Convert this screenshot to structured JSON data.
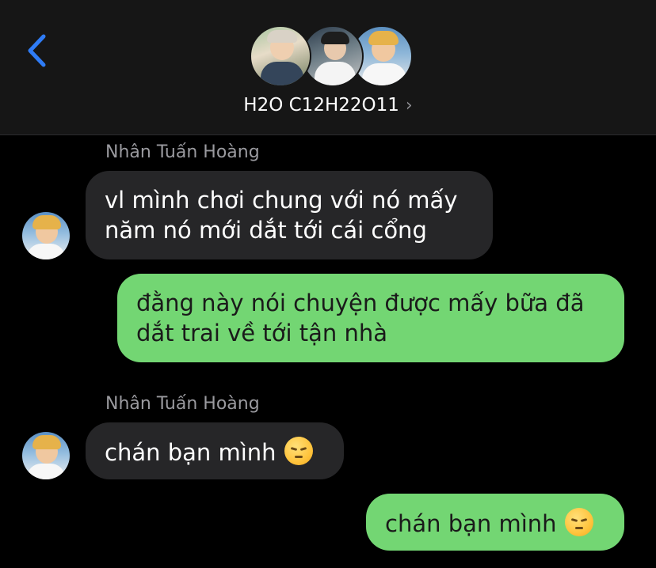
{
  "header": {
    "back_label": "",
    "group_name": "H2O C12H22O11",
    "chevron": "›"
  },
  "messages": [
    {
      "direction": "incoming",
      "sender": "Nhân Tuấn Hoàng",
      "lines": [
        "vl mình chơi chung với nó mấy",
        "năm nó mới dắt tới cái cổng"
      ]
    },
    {
      "direction": "outgoing",
      "lines": [
        "đằng này nói chuyện được mấy bữa đã",
        "dắt trai về tới tận nhà"
      ]
    },
    {
      "direction": "incoming",
      "sender": "Nhân Tuấn Hoàng",
      "text": "chán bạn mình",
      "emoji": "pensive-face-emoji"
    },
    {
      "direction": "outgoing",
      "text": "chán bạn mình",
      "emoji": "pensive-face-emoji"
    }
  ],
  "colors": {
    "header_bg": "#161616",
    "incoming_bubble": "#262628",
    "outgoing_bubble": "#73d673",
    "accent": "#2f7cf6"
  },
  "icons": [
    "chevron-left-icon",
    "chevron-right-icon",
    "pensive-face-emoji"
  ]
}
